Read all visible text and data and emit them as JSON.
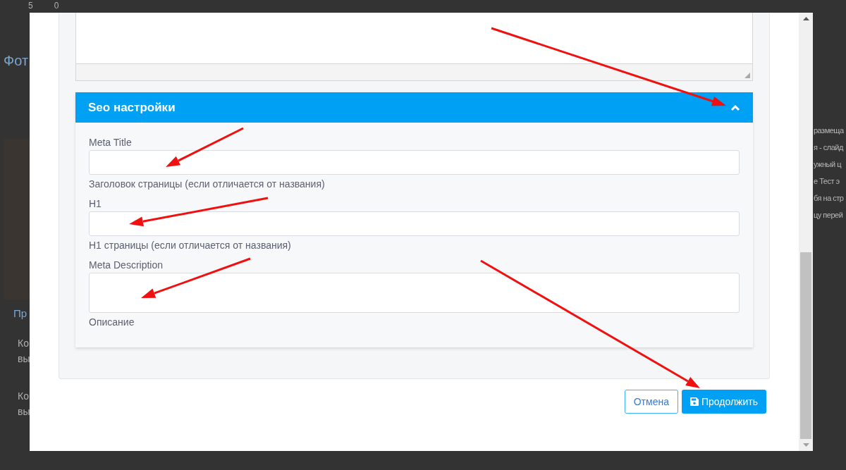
{
  "background": {
    "top_bar": [
      "5",
      "0"
    ],
    "left": [
      {
        "kind": "heading",
        "text": "Фот"
      },
      {
        "kind": "link",
        "text": "Пр"
      },
      {
        "kind": "text",
        "text": "Ко"
      },
      {
        "kind": "text",
        "text": "вы"
      },
      {
        "kind": "text",
        "text": "Ко"
      },
      {
        "kind": "text",
        "text": "вы"
      }
    ],
    "right": [
      "размеща",
      "я - слайд",
      "ужный ц",
      "е Тест э",
      "бя на стр",
      "цу перей"
    ]
  },
  "seo": {
    "title": "Seo настройки",
    "expanded": true,
    "fields": [
      {
        "label": "Meta Title",
        "kind": "input",
        "help": "Заголовок страницы (если отличается от названия)"
      },
      {
        "label": "H1",
        "kind": "input",
        "help": "H1 страницы (если отличается от названия)"
      },
      {
        "label": "Meta Description",
        "kind": "textarea",
        "help": "Описание"
      }
    ]
  },
  "buttons": [
    {
      "label": "Отмена",
      "kind": "secondary"
    },
    {
      "label": "Продолжить",
      "kind": "primary"
    }
  ]
}
